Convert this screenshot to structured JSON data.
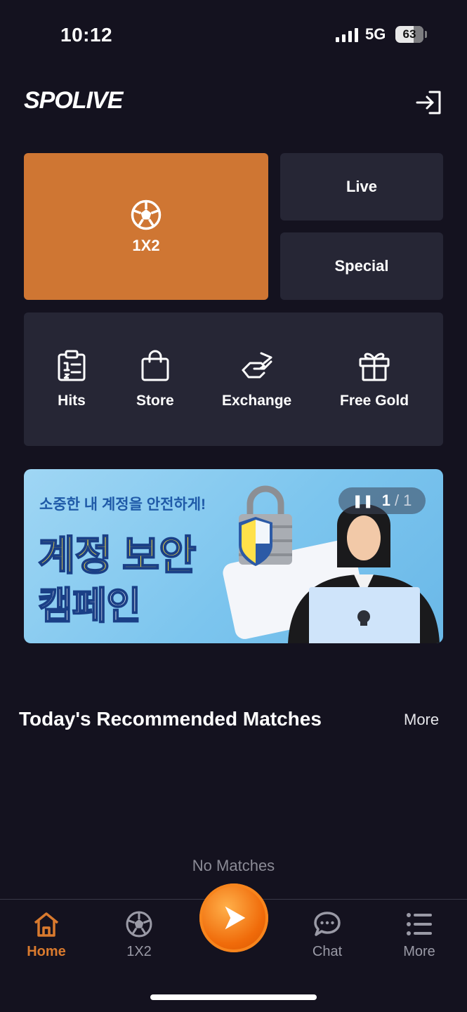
{
  "status_bar": {
    "time": "10:12",
    "network": "5G",
    "battery": "63"
  },
  "header": {
    "logo": "SPOLIVE"
  },
  "tiles": {
    "main": "1X2",
    "live": "Live",
    "special": "Special"
  },
  "menu": [
    {
      "label": "Hits",
      "icon": "clipboard-icon"
    },
    {
      "label": "Store",
      "icon": "shopping-bag-icon"
    },
    {
      "label": "Exchange",
      "icon": "exchange-icon"
    },
    {
      "label": "Free Gold",
      "icon": "gift-icon"
    }
  ],
  "banner": {
    "subtitle": "소중한 내 계정을 안전하게!",
    "title_line1": "계정 보안",
    "title_line2": "캠페인",
    "pager_current": "1",
    "pager_sep": "/",
    "pager_total": "1"
  },
  "section": {
    "title": "Today's Recommended Matches",
    "more": "More",
    "empty": "No Matches"
  },
  "tabbar": [
    {
      "label": "Home",
      "icon": "home-icon",
      "active": true
    },
    {
      "label": "1X2",
      "icon": "soccer-ball-icon"
    },
    {
      "label": "",
      "icon": "play-icon"
    },
    {
      "label": "Chat",
      "icon": "chat-bubble-icon"
    },
    {
      "label": "More",
      "icon": "list-icon"
    }
  ],
  "colors": {
    "accent": "#cf7633",
    "background": "#14121f",
    "tile": "#262635"
  }
}
